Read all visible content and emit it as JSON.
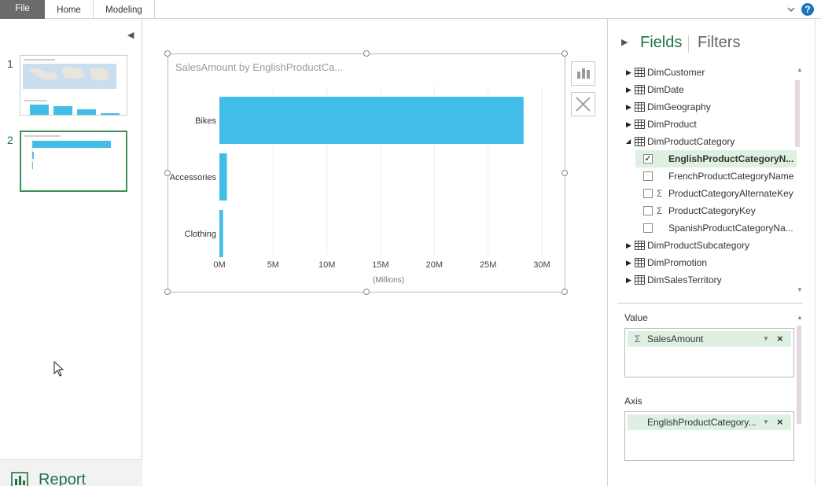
{
  "ribbon": {
    "tabs": [
      "File",
      "Home",
      "Modeling"
    ]
  },
  "pages": {
    "items": [
      {
        "number": "1",
        "active": false
      },
      {
        "number": "2",
        "active": true
      }
    ],
    "report_label": "Report"
  },
  "visual": {
    "title": "SalesAmount by EnglishProductCa..."
  },
  "chart_data": {
    "type": "bar",
    "orientation": "horizontal",
    "title": "SalesAmount by EnglishProductCa...",
    "categories": [
      "Bikes",
      "Accessories",
      "Clothing"
    ],
    "values": [
      28.3,
      0.7,
      0.34
    ],
    "unit": "millions",
    "xlabel": "(Millions)",
    "ylabel": "",
    "xlim": [
      0,
      30
    ],
    "x_ticks": [
      "0M",
      "5M",
      "10M",
      "15M",
      "20M",
      "25M",
      "30M"
    ],
    "grid": true,
    "bar_color": "#41bde9"
  },
  "fields_pane": {
    "title": "Fields",
    "filters_tab": "Filters",
    "tables": [
      {
        "name": "DimCustomer",
        "expanded": false
      },
      {
        "name": "DimDate",
        "expanded": false
      },
      {
        "name": "DimGeography",
        "expanded": false
      },
      {
        "name": "DimProduct",
        "expanded": false
      },
      {
        "name": "DimProductCategory",
        "expanded": true
      },
      {
        "name": "DimProductSubcategory",
        "expanded": false
      },
      {
        "name": "DimPromotion",
        "expanded": false
      },
      {
        "name": "DimSalesTerritory",
        "expanded": false
      }
    ],
    "category_fields": [
      {
        "name": "EnglishProductCategoryN...",
        "checked": true,
        "sigma": false
      },
      {
        "name": "FrenchProductCategoryName",
        "checked": false,
        "sigma": false
      },
      {
        "name": "ProductCategoryAlternateKey",
        "checked": false,
        "sigma": true
      },
      {
        "name": "ProductCategoryKey",
        "checked": false,
        "sigma": true
      },
      {
        "name": "SpanishProductCategoryNa...",
        "checked": false,
        "sigma": false
      }
    ],
    "value_label": "Value",
    "value_field": "SalesAmount",
    "axis_label": "Axis",
    "axis_field": "EnglishProductCategory..."
  },
  "colors": {
    "accent": "#217346",
    "bar": "#41bde9",
    "file_tab": "#6b6b6b",
    "selected_row": "#def0e2"
  }
}
